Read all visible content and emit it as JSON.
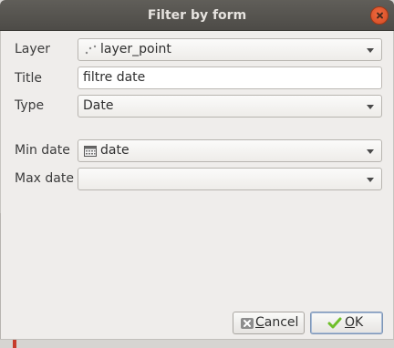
{
  "window": {
    "title": "Filter by form"
  },
  "form": {
    "layer": {
      "label": "Layer",
      "value": "layer_point"
    },
    "title": {
      "label": "Title",
      "value": "filtre date"
    },
    "type": {
      "label": "Type",
      "value": "Date"
    },
    "min_date": {
      "label": "Min date",
      "value": "date"
    },
    "max_date": {
      "label": "Max date",
      "value": ""
    }
  },
  "buttons": {
    "cancel": {
      "label_mnemonic": "C",
      "label_rest": "ancel"
    },
    "ok": {
      "label_mnemonic": "O",
      "label_rest": "K"
    }
  },
  "icons": {
    "layer_icon": "point-layer-icon",
    "min_date_icon": "calendar-icon",
    "cancel_icon": "cancel-icon",
    "ok_icon": "check-icon"
  },
  "colors": {
    "titlebar": "#55534f",
    "dialog_bg": "#efedeb",
    "close_button": "#e25a2f",
    "ok_check": "#6fbf2a"
  }
}
